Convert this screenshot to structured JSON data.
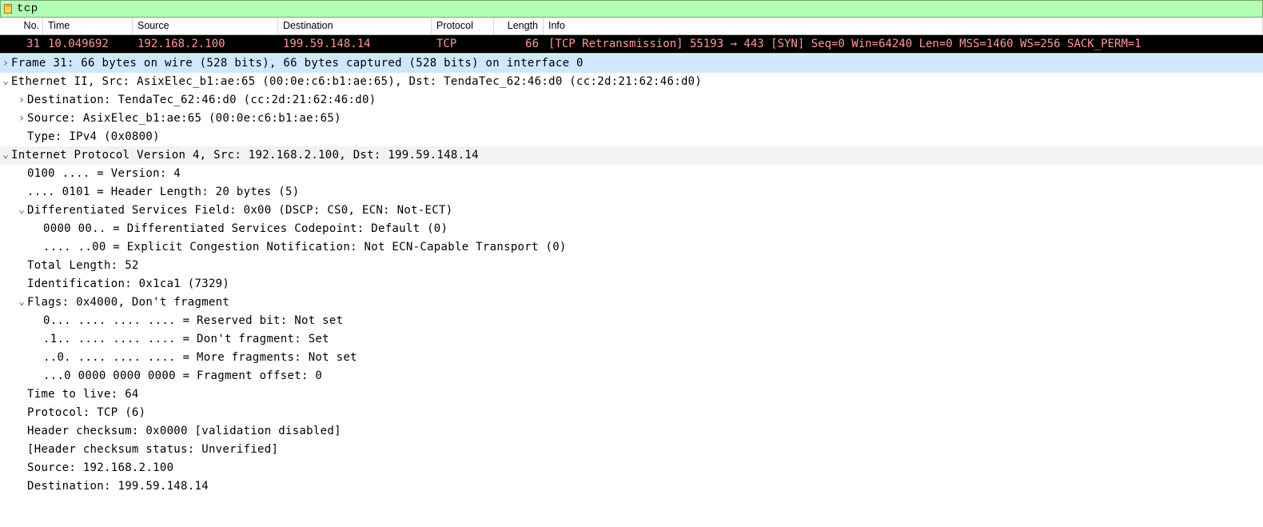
{
  "filter": {
    "value": "tcp"
  },
  "columns": {
    "no": "No.",
    "time": "Time",
    "source": "Source",
    "destination": "Destination",
    "protocol": "Protocol",
    "length": "Length",
    "info": "Info"
  },
  "packet": {
    "no": "31",
    "time": "10.049692",
    "source": "192.168.2.100",
    "destination": "199.59.148.14",
    "protocol": "TCP",
    "length": "66",
    "info": "[TCP Retransmission] 55193 → 443 [SYN] Seq=0 Win=64240 Len=0 MSS=1460 WS=256 SACK_PERM=1"
  },
  "details": {
    "frame": "Frame 31: 66 bytes on wire (528 bits), 66 bytes captured (528 bits) on interface 0",
    "eth": {
      "summary": "Ethernet II, Src: AsixElec_b1:ae:65 (00:0e:c6:b1:ae:65), Dst: TendaTec_62:46:d0 (cc:2d:21:62:46:d0)",
      "dst": "Destination: TendaTec_62:46:d0 (cc:2d:21:62:46:d0)",
      "src": "Source: AsixElec_b1:ae:65 (00:0e:c6:b1:ae:65)",
      "type": "Type: IPv4 (0x0800)"
    },
    "ip": {
      "summary": "Internet Protocol Version 4, Src: 192.168.2.100, Dst: 199.59.148.14",
      "version": "0100 .... = Version: 4",
      "hdrlen": ".... 0101 = Header Length: 20 bytes (5)",
      "dsfield": {
        "summary": "Differentiated Services Field: 0x00 (DSCP: CS0, ECN: Not-ECT)",
        "dscp": "0000 00.. = Differentiated Services Codepoint: Default (0)",
        "ecn": ".... ..00 = Explicit Congestion Notification: Not ECN-Capable Transport (0)"
      },
      "totlen": "Total Length: 52",
      "id": "Identification: 0x1ca1 (7329)",
      "flags": {
        "summary": "Flags: 0x4000, Don't fragment",
        "reserved": "0... .... .... .... = Reserved bit: Not set",
        "df": ".1.. .... .... .... = Don't fragment: Set",
        "mf": "..0. .... .... .... = More fragments: Not set",
        "frag": "...0 0000 0000 0000 = Fragment offset: 0"
      },
      "ttl": "Time to live: 64",
      "protocol": "Protocol: TCP (6)",
      "checksum": "Header checksum: 0x0000 [validation disabled]",
      "checksum_status": "[Header checksum status: Unverified]",
      "src": "Source: 192.168.2.100",
      "dst": "Destination: 199.59.148.14"
    }
  }
}
